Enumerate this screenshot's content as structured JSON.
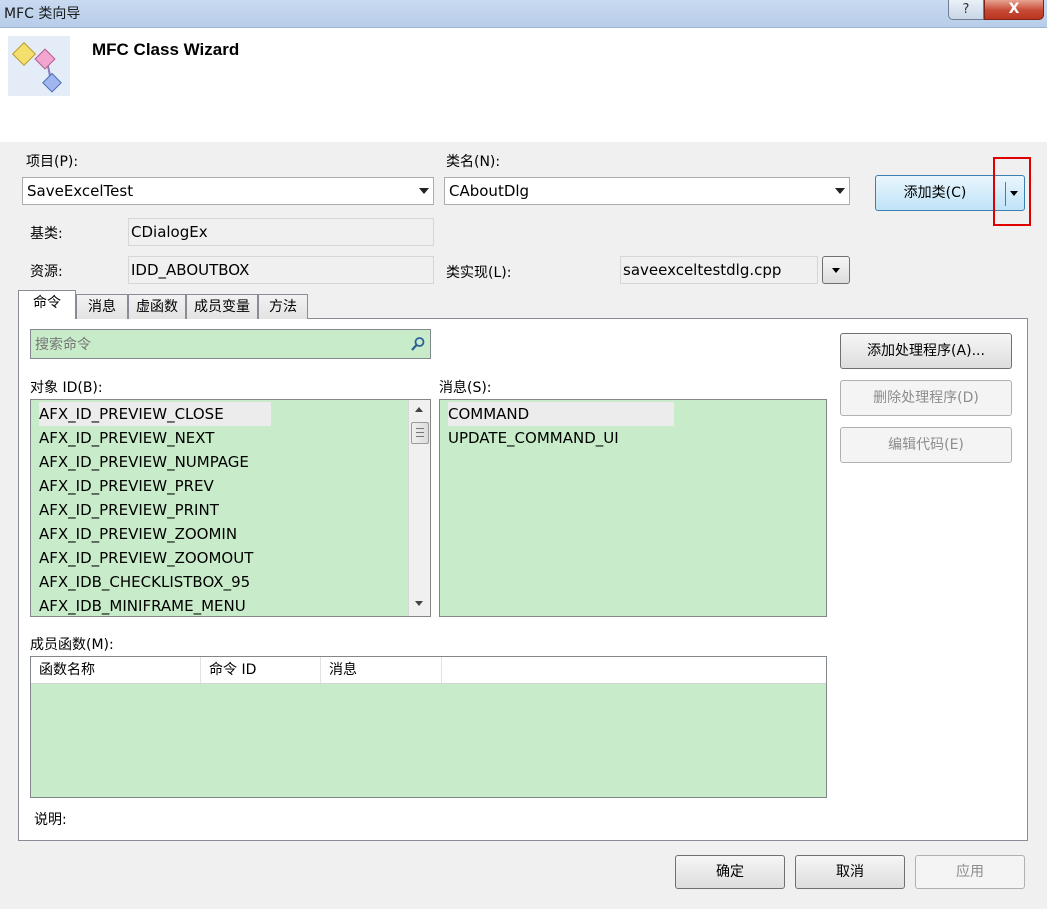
{
  "window": {
    "title": "MFC 类向导",
    "help_label": "?",
    "close_label": "X"
  },
  "header": {
    "title": "MFC Class Wizard"
  },
  "project": {
    "label": "项目(P):",
    "value": "SaveExcelTest"
  },
  "classname": {
    "label": "类名(N):",
    "value": "CAboutDlg"
  },
  "add_class": {
    "label": "添加类(C)"
  },
  "base_class": {
    "label": "基类:",
    "value": "CDialogEx"
  },
  "resource": {
    "label": "资源:",
    "value": "IDD_ABOUTBOX"
  },
  "class_impl": {
    "label": "类实现(L):",
    "value": "saveexceltestdlg.cpp"
  },
  "tabs": [
    {
      "label": "命令"
    },
    {
      "label": "消息"
    },
    {
      "label": "虚函数"
    },
    {
      "label": "成员变量"
    },
    {
      "label": "方法"
    }
  ],
  "search": {
    "placeholder": "搜索命令"
  },
  "object_ids": {
    "label": "对象 ID(B):",
    "items": [
      "AFX_ID_PREVIEW_CLOSE",
      "AFX_ID_PREVIEW_NEXT",
      "AFX_ID_PREVIEW_NUMPAGE",
      "AFX_ID_PREVIEW_PREV",
      "AFX_ID_PREVIEW_PRINT",
      "AFX_ID_PREVIEW_ZOOMIN",
      "AFX_ID_PREVIEW_ZOOMOUT",
      "AFX_IDB_CHECKLISTBOX_95",
      "AFX_IDB_MINIFRAME_MENU"
    ]
  },
  "messages": {
    "label": "消息(S):",
    "items": [
      "COMMAND",
      "UPDATE_COMMAND_UI"
    ]
  },
  "actions": {
    "add_handler": "添加处理程序(A)...",
    "delete_handler": "删除处理程序(D)",
    "edit_code": "编辑代码(E)"
  },
  "member_functions": {
    "label": "成员函数(M):",
    "columns": [
      "函数名称",
      "命令 ID",
      "消息"
    ]
  },
  "description": {
    "label": "说明:"
  },
  "footer": {
    "ok": "确定",
    "cancel": "取消",
    "apply": "应用"
  }
}
